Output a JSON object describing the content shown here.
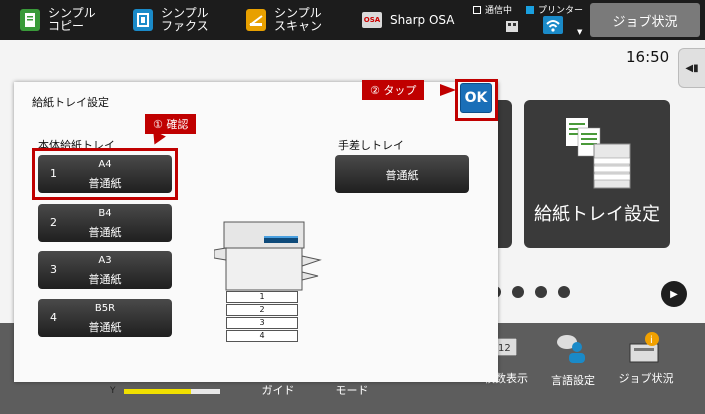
{
  "topbar": {
    "apps": [
      {
        "label1": "シンプル",
        "label2": "コピー"
      },
      {
        "label1": "シンプル",
        "label2": "ファクス"
      },
      {
        "label1": "シンプル",
        "label2": "スキャン"
      },
      {
        "label1": "Sharp OSA",
        "label2": ""
      }
    ],
    "osa_logo": "OSA",
    "status_comm": "通信中",
    "status_printer": "プリンター",
    "job_status_button": "ジョブ状況"
  },
  "home": {
    "clock": "16:50",
    "side_tab_icon": "◀▮",
    "tile_paper_tray_label": "給紙トレイ設定",
    "page_dots": 4,
    "bottom": {
      "items": [
        {
          "label": "ガイド"
        },
        {
          "label": "モード"
        },
        {
          "label": "枚数表示"
        },
        {
          "label": "言語設定"
        },
        {
          "label": "ジョブ状況"
        }
      ],
      "y_label": "Y",
      "toner_level": 0.7
    }
  },
  "dialog": {
    "title": "給紙トレイ設定",
    "main_tray_heading": "本体給紙トレイ",
    "manual_tray_heading": "手差しトレイ",
    "ok_button": "OK",
    "trays": [
      {
        "num": "1",
        "size": "A4",
        "type": "普通紙"
      },
      {
        "num": "2",
        "size": "B4",
        "type": "普通紙"
      },
      {
        "num": "3",
        "size": "A3",
        "type": "普通紙"
      },
      {
        "num": "4",
        "size": "B5R",
        "type": "普通紙"
      }
    ],
    "manual_tray": {
      "type": "普通紙"
    },
    "printer_slots": [
      "1",
      "2",
      "3",
      "4"
    ]
  },
  "annotations": {
    "confirm": "① 確認",
    "tap": "② タップ"
  },
  "colors": {
    "annotation_red": "#c00000",
    "ok_blue": "#1a6fb8",
    "toner_yellow": "#f0e000"
  }
}
